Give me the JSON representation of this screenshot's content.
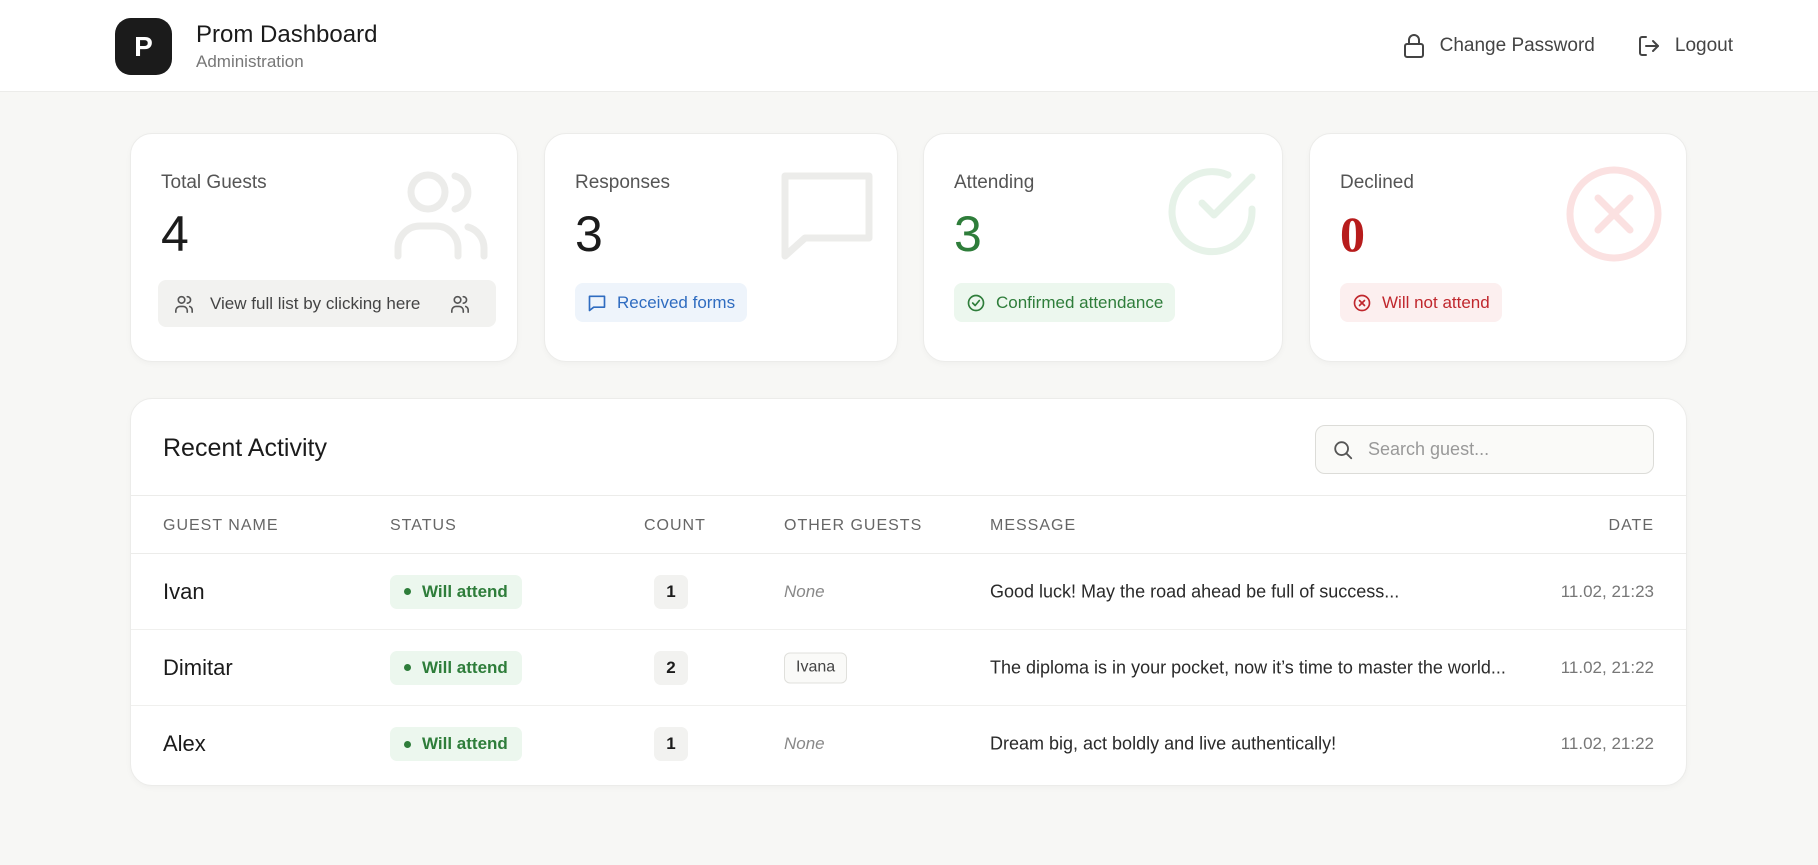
{
  "header": {
    "logo_letter": "P",
    "title": "Prom Dashboard",
    "subtitle": "Administration",
    "change_password": "Change Password",
    "logout": "Logout"
  },
  "stats": {
    "total": {
      "label": "Total Guests",
      "value": "4",
      "chip": "View full list by clicking here"
    },
    "responses": {
      "label": "Responses",
      "value": "3",
      "chip": "Received forms"
    },
    "attending": {
      "label": "Attending",
      "value": "3",
      "chip": "Confirmed attendance"
    },
    "declined": {
      "label": "Declined",
      "value": "0",
      "chip": "Will not attend"
    }
  },
  "activity": {
    "title": "Recent Activity",
    "search_placeholder": "Search guest...",
    "columns": [
      "GUEST NAME",
      "STATUS",
      "COUNT",
      "OTHER GUESTS",
      "MESSAGE",
      "DATE"
    ],
    "rows": [
      {
        "name": "Ivan",
        "status": "Will attend",
        "count": "1",
        "other": "None",
        "message": "Good luck! May the road ahead be full of success...",
        "date": "11.02, 21:23"
      },
      {
        "name": "Dimitar",
        "status": "Will attend",
        "count": "2",
        "other": "Ivana",
        "message": "The diploma is in your pocket, now it’s time to master the world...",
        "date": "11.02, 21:22"
      },
      {
        "name": "Alex",
        "status": "Will attend",
        "count": "1",
        "other": "None",
        "message": "Dream big, act boldly and live authentically!",
        "date": "11.02, 21:22"
      }
    ]
  },
  "colors": {
    "green": "#2e7d3a",
    "red": "#b71c1c",
    "blue": "#2f6cc0"
  }
}
